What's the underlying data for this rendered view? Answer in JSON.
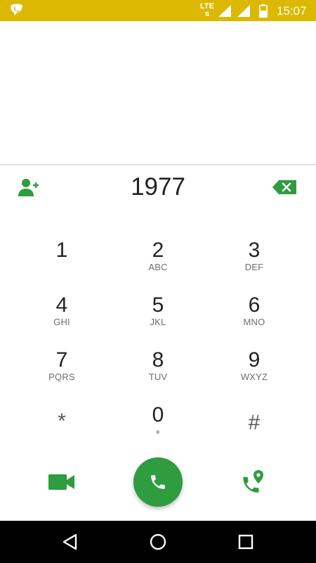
{
  "status_bar": {
    "network": "LTE",
    "time": "15:07",
    "icons": [
      "wifi-call-icon",
      "lte-icon",
      "signal-icon",
      "signal-icon",
      "battery-icon"
    ]
  },
  "dialer": {
    "number": "1977",
    "keys": [
      {
        "digit": "1",
        "letters": ""
      },
      {
        "digit": "2",
        "letters": "ABC"
      },
      {
        "digit": "3",
        "letters": "DEF"
      },
      {
        "digit": "4",
        "letters": "GHI"
      },
      {
        "digit": "5",
        "letters": "JKL"
      },
      {
        "digit": "6",
        "letters": "MNO"
      },
      {
        "digit": "7",
        "letters": "PQRS"
      },
      {
        "digit": "8",
        "letters": "TUV"
      },
      {
        "digit": "9",
        "letters": "WXYZ"
      },
      {
        "digit": "*",
        "letters": ""
      },
      {
        "digit": "0",
        "letters": "+"
      },
      {
        "digit": "#",
        "letters": ""
      }
    ],
    "actions": [
      "add-contact-icon",
      "backspace-icon",
      "video-call-icon",
      "call-icon",
      "location-call-icon"
    ]
  },
  "navigation": {
    "buttons": [
      "back-icon",
      "home-icon",
      "recents-icon"
    ]
  },
  "colors": {
    "status_bar": "#dcb800",
    "accent": "#2e9c3f",
    "nav_bar": "#000000"
  }
}
